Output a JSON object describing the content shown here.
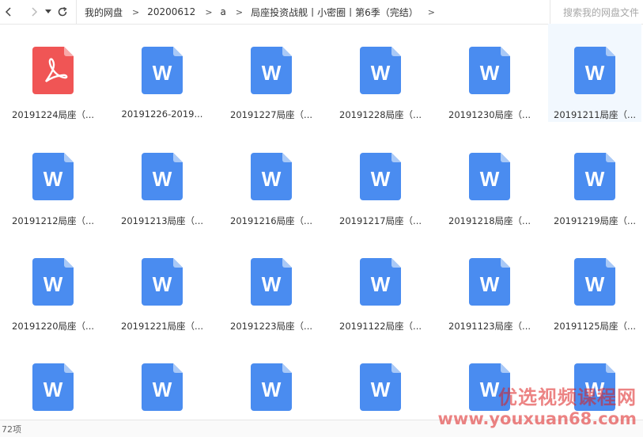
{
  "toolbar": {
    "breadcrumbs": [
      "我的网盘",
      "20200612",
      "a",
      "局座投资战舰丨小密圈丨第6季（完结）"
    ],
    "search_placeholder": "搜索我的网盘文件"
  },
  "files": [
    {
      "name": "20191224局座（...",
      "type": "pdf"
    },
    {
      "name": "20191226-2019...",
      "type": "word"
    },
    {
      "name": "20191227局座（...",
      "type": "word"
    },
    {
      "name": "20191228局座（...",
      "type": "word"
    },
    {
      "name": "20191230局座（...",
      "type": "word"
    },
    {
      "name": "20191211局座（...",
      "type": "word",
      "selected": true
    },
    {
      "name": "20191212局座（...",
      "type": "word"
    },
    {
      "name": "20191213局座（...",
      "type": "word"
    },
    {
      "name": "20191216局座（...",
      "type": "word"
    },
    {
      "name": "20191217局座（...",
      "type": "word"
    },
    {
      "name": "20191218局座（...",
      "type": "word"
    },
    {
      "name": "20191219局座（...",
      "type": "word"
    },
    {
      "name": "20191220局座（...",
      "type": "word"
    },
    {
      "name": "20191221局座（...",
      "type": "word"
    },
    {
      "name": "20191223局座（...",
      "type": "word"
    },
    {
      "name": "20191122局座（...",
      "type": "word"
    },
    {
      "name": "20191123局座（...",
      "type": "word"
    },
    {
      "name": "20191125局座（...",
      "type": "word"
    },
    {
      "name": "",
      "type": "word"
    },
    {
      "name": "",
      "type": "word"
    },
    {
      "name": "",
      "type": "word"
    },
    {
      "name": "",
      "type": "word"
    },
    {
      "name": "",
      "type": "word"
    },
    {
      "name": "",
      "type": "word"
    }
  ],
  "status": {
    "count": "72项"
  },
  "watermark": {
    "line1": "优选视频课程网",
    "line2": "www.youxuan68.com"
  },
  "colors": {
    "word": "#4a8cf0",
    "word_fold": "#a9c9f7",
    "pdf": "#f05555",
    "pdf_fold": "#f8a9a9",
    "selected_bg": "#f2f8fe"
  }
}
